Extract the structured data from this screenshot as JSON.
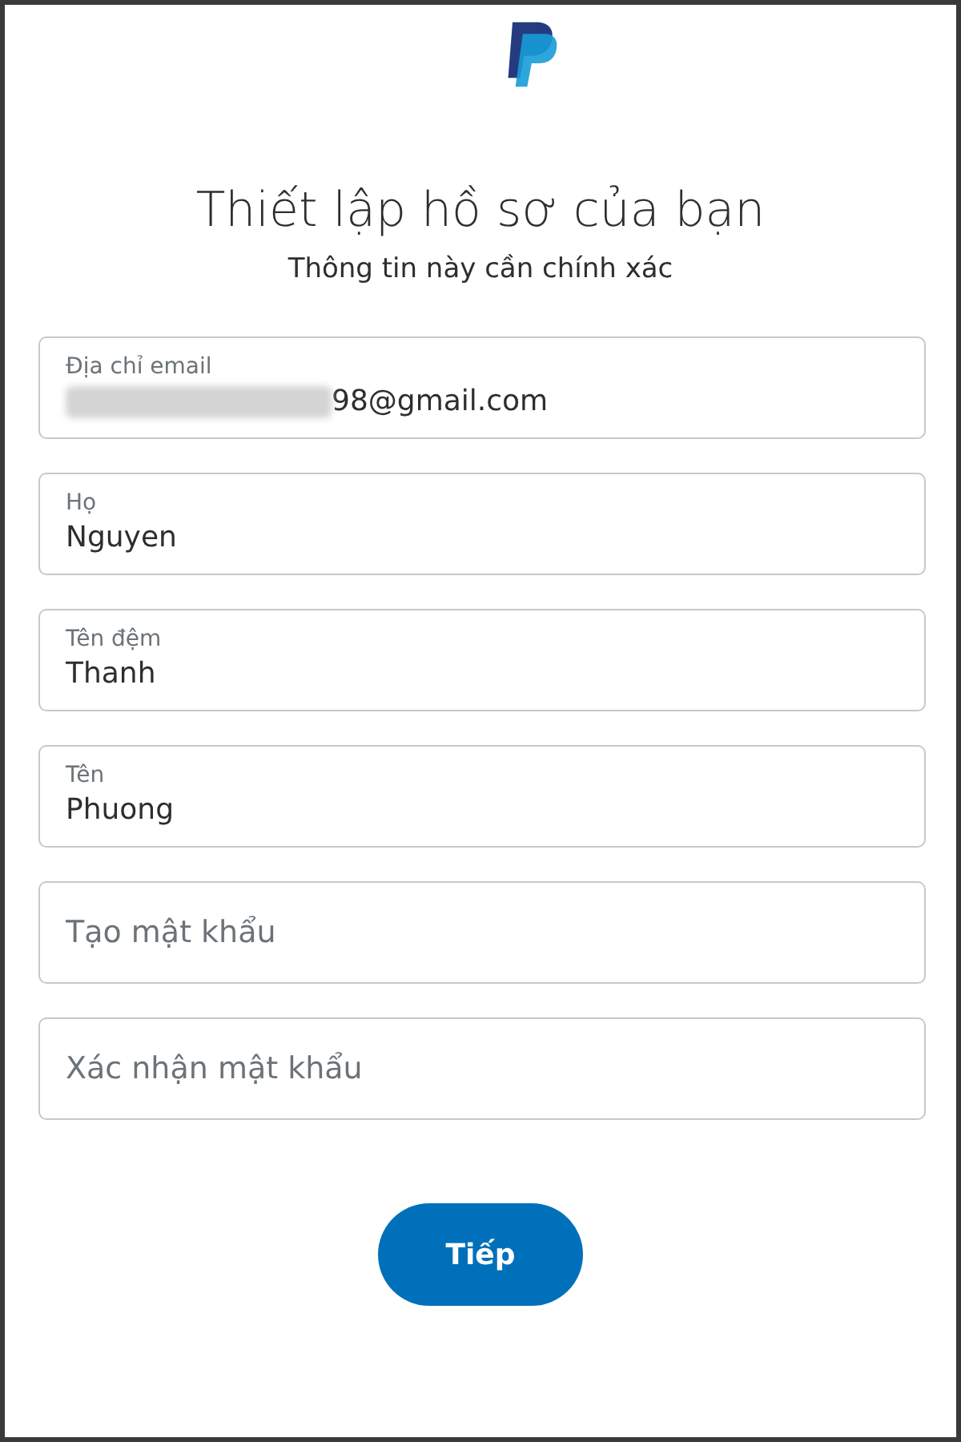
{
  "title": "Thiết lập hồ sơ của bạn",
  "subtitle": "Thông tin này cần chính xác",
  "fields": [
    {
      "kind": "filled",
      "label": "Địa chỉ email",
      "value": "98@gmail.com",
      "redacted": true
    },
    {
      "kind": "filled",
      "label": "Họ",
      "value": "Nguyen",
      "redacted": false
    },
    {
      "kind": "filled",
      "label": "Tên đệm",
      "value": "Thanh",
      "redacted": false
    },
    {
      "kind": "filled",
      "label": "Tên",
      "value": "Phuong",
      "redacted": false
    },
    {
      "kind": "empty",
      "placeholder": "Tạo mật khẩu"
    },
    {
      "kind": "empty",
      "placeholder": "Xác nhận mật khẩu"
    }
  ],
  "button": "Tiếp"
}
